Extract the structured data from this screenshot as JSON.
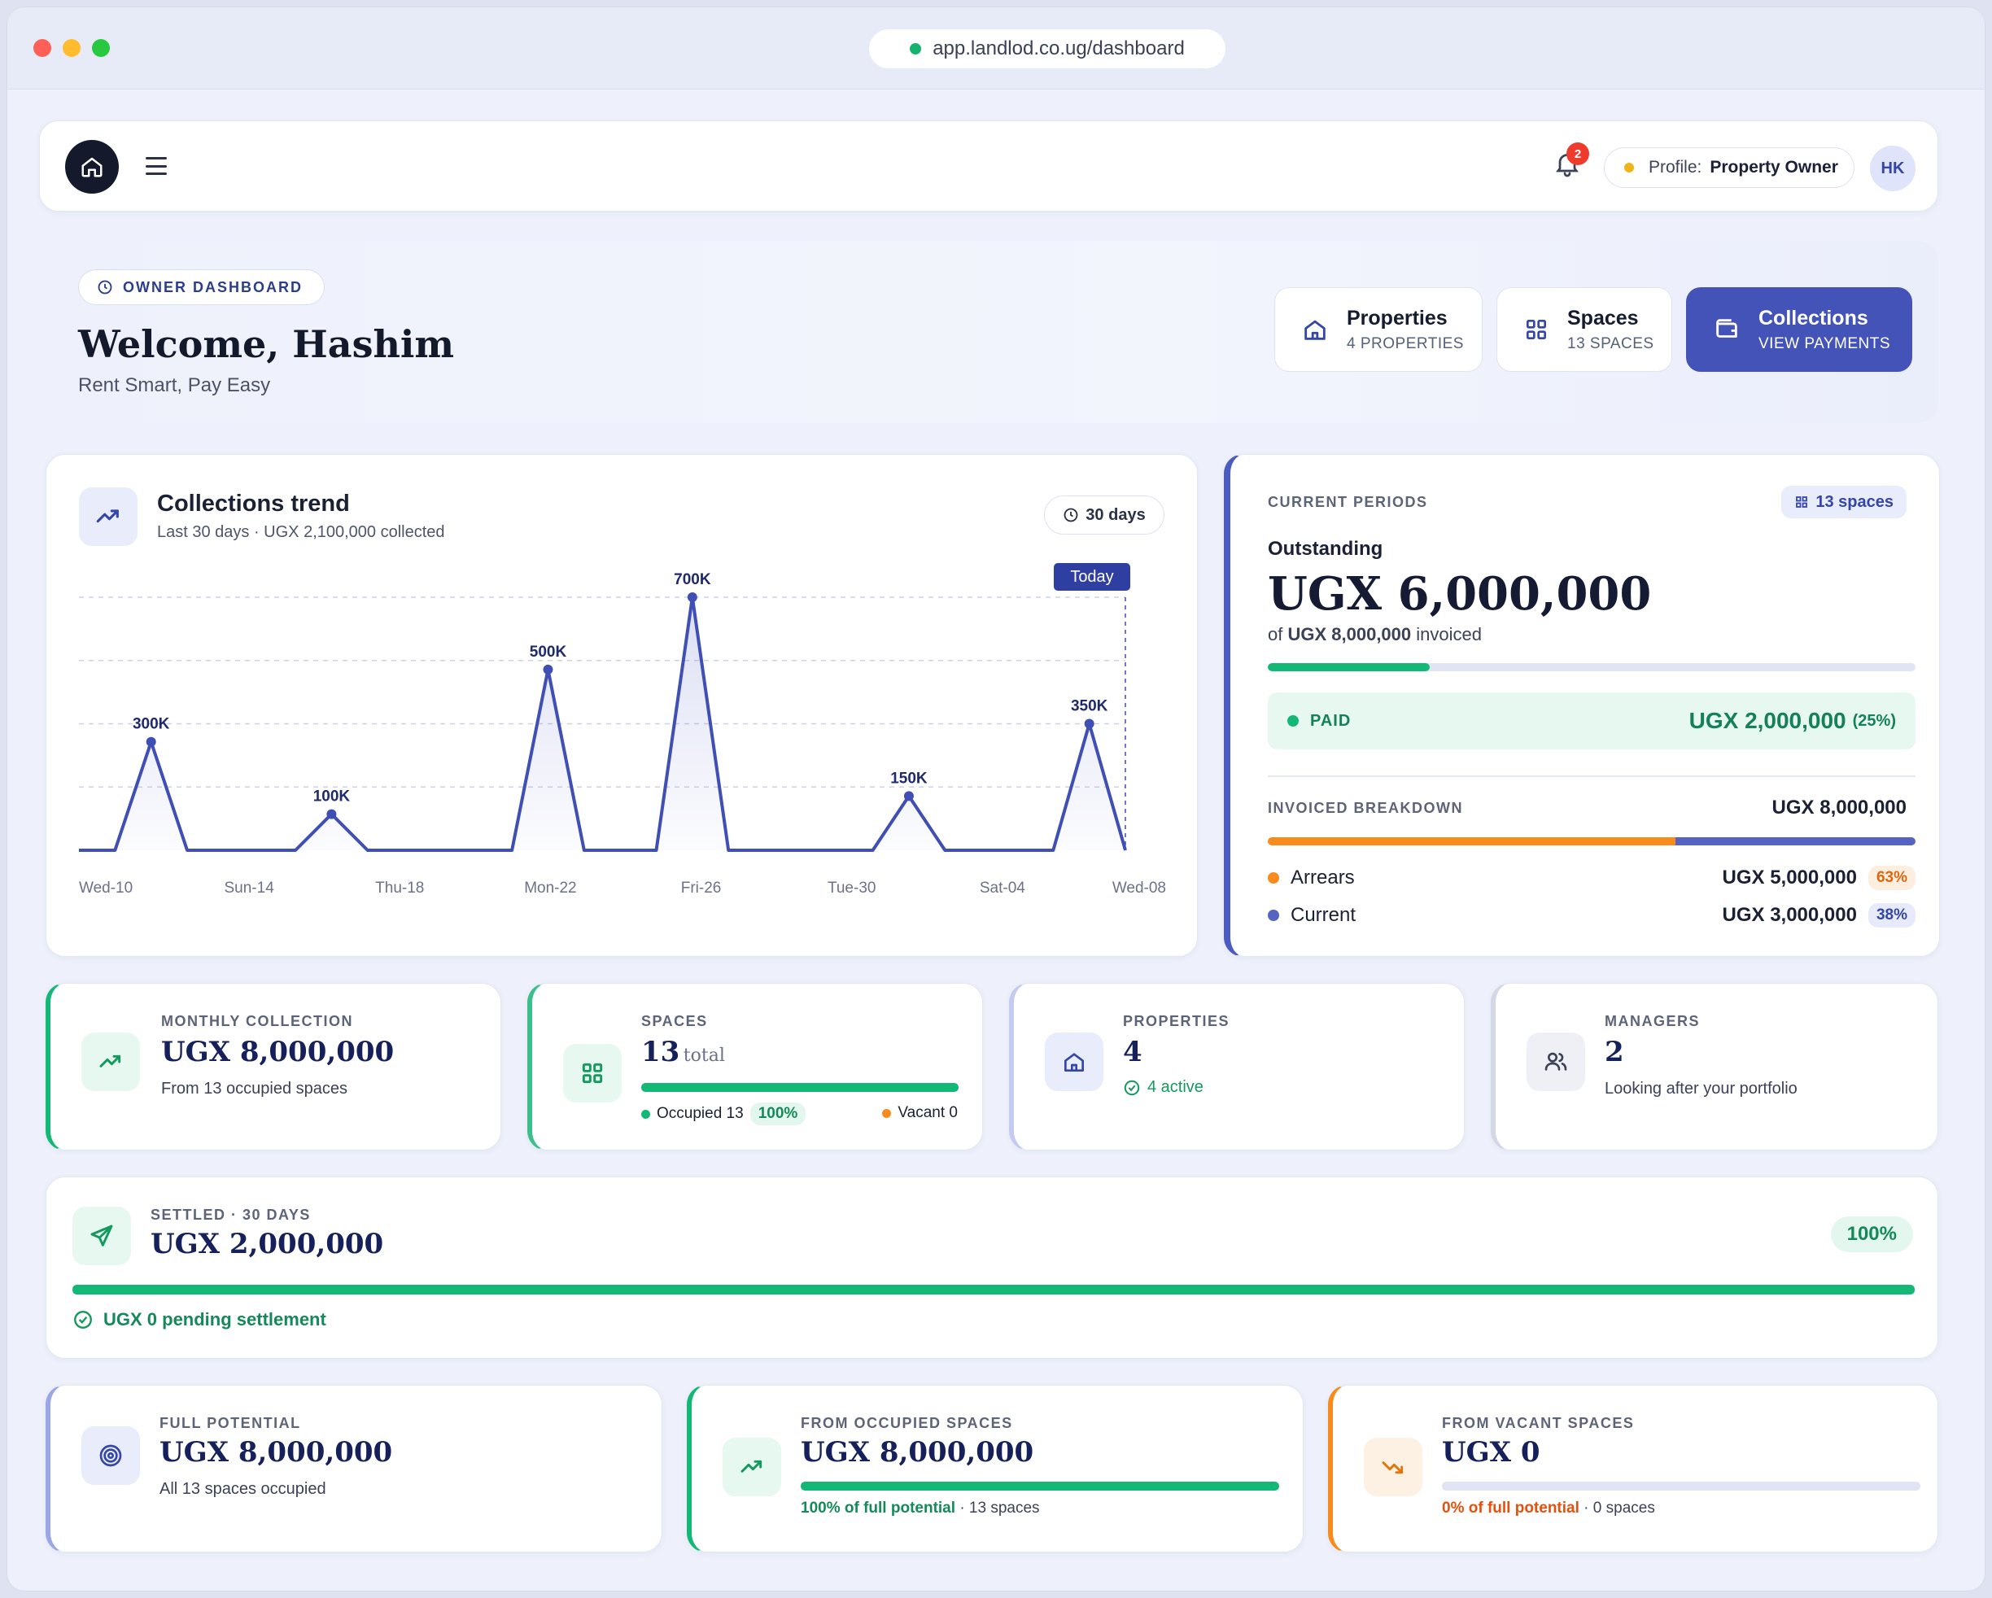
{
  "browser": {
    "url": "app.landlod.co.ug/dashboard"
  },
  "topbar": {
    "notification_count": "2",
    "profile_label": "Profile:",
    "profile_value": "Property Owner",
    "avatar_initials": "HK"
  },
  "hero": {
    "pill": "OWNER DASHBOARD",
    "welcome": "Welcome, Hashim",
    "tagline": "Rent Smart, Pay Easy",
    "quick_links": [
      {
        "title": "Properties",
        "subtitle": "4 PROPERTIES"
      },
      {
        "title": "Spaces",
        "subtitle": "13 SPACES"
      },
      {
        "title": "Collections",
        "subtitle": "VIEW PAYMENTS"
      }
    ]
  },
  "trend": {
    "title": "Collections trend",
    "subtitle": "Last 30 days · UGX 2,100,000 collected",
    "range": "30 days",
    "today_label": "Today"
  },
  "chart_data": {
    "type": "area",
    "title": "Collections trend",
    "x_ticks": [
      "Wed-10",
      "Sun-14",
      "Thu-18",
      "Mon-22",
      "Fri-26",
      "Tue-30",
      "Sat-04",
      "Wed-08"
    ],
    "x": [
      "Wed-10",
      "Thu-11",
      "Fri-12",
      "Sat-13",
      "Sun-14",
      "Mon-15",
      "Tue-16",
      "Wed-17",
      "Thu-18",
      "Fri-19",
      "Sat-20",
      "Sun-21",
      "Mon-22",
      "Tue-23",
      "Wed-24",
      "Thu-25",
      "Fri-26",
      "Sat-27",
      "Sun-28",
      "Mon-29",
      "Tue-30",
      "Wed-01",
      "Thu-02",
      "Fri-03",
      "Sat-04",
      "Sun-05",
      "Mon-06",
      "Tue-07",
      "Wed-08"
    ],
    "series": [
      {
        "values": [
          0,
          0,
          300000,
          0,
          0,
          0,
          0,
          100000,
          0,
          0,
          0,
          0,
          0,
          500000,
          0,
          0,
          0,
          700000,
          0,
          0,
          0,
          0,
          0,
          150000,
          0,
          0,
          0,
          0,
          350000,
          0
        ],
        "point_labels": {
          "2": "300K",
          "7": "100K",
          "13": "500K",
          "17": "700K",
          "23": "150K",
          "28": "350K"
        }
      }
    ],
    "ylim": [
      0,
      700000
    ],
    "grid": true,
    "color": "#3f4fb3"
  },
  "current": {
    "label": "CURRENT PERIODS",
    "spaces_chip": "13 spaces",
    "outstanding_label": "Outstanding",
    "outstanding_value": "UGX 6,000,000",
    "of_prefix": "of",
    "of_amount": "UGX 8,000,000",
    "of_suffix": "invoiced",
    "paid_fraction": 0.25,
    "paid_label": "PAID",
    "paid_value": "UGX 2,000,000",
    "paid_pct": "(25%)",
    "breakdown_label": "INVOICED BREAKDOWN",
    "breakdown_total": "UGX 8,000,000",
    "arrears_fraction": 0.63,
    "rows": [
      {
        "name": "Arrears",
        "value": "UGX 5,000,000",
        "pct": "63%"
      },
      {
        "name": "Current",
        "value": "UGX 3,000,000",
        "pct": "38%"
      }
    ]
  },
  "stats": [
    {
      "label": "MONTHLY COLLECTION",
      "value": "UGX 8,000,000",
      "sub": "From 13 occupied spaces"
    },
    {
      "label": "SPACES",
      "value": "13",
      "value_suffix": "total",
      "occupied": "Occupied 13",
      "occupied_pct": "100%",
      "vacant": "Vacant 0",
      "occupied_fraction": 1.0
    },
    {
      "label": "PROPERTIES",
      "value": "4",
      "sub": "4 active"
    },
    {
      "label": "MANAGERS",
      "value": "2",
      "sub": "Looking after your portfolio"
    }
  ],
  "settled": {
    "label": "SETTLED · 30 DAYS",
    "value": "UGX 2,000,000",
    "pct": "100%",
    "fraction": 1.0,
    "pending": "UGX 0 pending settlement"
  },
  "potential": [
    {
      "label": "FULL POTENTIAL",
      "value": "UGX 8,000,000",
      "sub": "All 13 spaces occupied"
    },
    {
      "label": "FROM OCCUPIED SPACES",
      "value": "UGX 8,000,000",
      "fraction": 1.0,
      "pct_text": "100% of full potential",
      "sub": "· 13 spaces"
    },
    {
      "label": "FROM VACANT SPACES",
      "value": "UGX 0",
      "fraction": 0.0,
      "pct_text": "0% of full potential",
      "sub": "· 0 spaces"
    }
  ]
}
